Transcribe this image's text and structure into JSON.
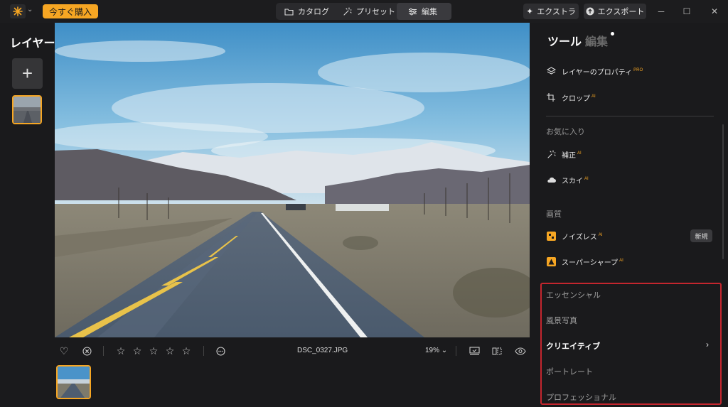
{
  "titlebar": {
    "buy_label": "今すぐ購入",
    "tabs": [
      {
        "label": "カタログ",
        "icon": "folder-icon"
      },
      {
        "label": "プリセット",
        "icon": "magic-wand-icon"
      },
      {
        "label": "編集",
        "icon": "sliders-icon",
        "active": true
      }
    ],
    "extra_label": "エクストラ",
    "export_label": "エクスポート"
  },
  "left_panel": {
    "title": "レイヤー",
    "add_symbol": "+"
  },
  "bottom_bar": {
    "filename": "DSC_0327.JPG",
    "zoom": "19%",
    "rating": 0
  },
  "right_panel": {
    "tools_label": "ツール",
    "edit_label": "編集",
    "items_top": [
      {
        "label": "レイヤーのプロパティ",
        "badge": "PRO"
      },
      {
        "label": "クロップ",
        "badge": "AI"
      }
    ],
    "favorites_label": "お気に入り",
    "favorites": [
      {
        "label": "補正",
        "badge": "AI"
      },
      {
        "label": "スカイ",
        "badge": "AI"
      }
    ],
    "quality_label": "画質",
    "quality": [
      {
        "label": "ノイズレス",
        "badge": "AI",
        "tag": "新規"
      },
      {
        "label": "スーパーシャープ",
        "badge": "AI"
      }
    ],
    "categories": [
      {
        "label": "エッセンシャル"
      },
      {
        "label": "風景写真"
      },
      {
        "label": "クリエイティブ",
        "active": true
      },
      {
        "label": "ポートレート"
      },
      {
        "label": "プロフェッショナル"
      }
    ]
  },
  "colors": {
    "accent": "#f6a623",
    "highlight_box": "#c4262e",
    "background": "#1a1a1c"
  }
}
